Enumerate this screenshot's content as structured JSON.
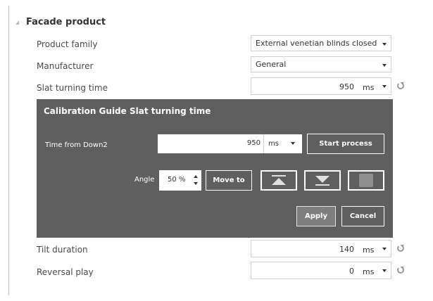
{
  "section": {
    "title": "Facade product"
  },
  "rows": {
    "product_family": {
      "label": "Product family",
      "value": "External venetian blinds closed"
    },
    "manufacturer": {
      "label": "Manufacturer",
      "value": "General"
    },
    "slat_turning_time": {
      "label": "Slat turning time",
      "value": "950",
      "unit": "ms"
    },
    "tilt_duration": {
      "label": "Tilt duration",
      "value": "140",
      "unit": "ms"
    },
    "reversal_play": {
      "label": "Reversal play",
      "value": "0",
      "unit": "ms"
    }
  },
  "dialog": {
    "title": "Calibration Guide Slat turning time",
    "time_label": "Time from Down2",
    "time_value": "950",
    "time_unit": "ms",
    "start_button": "Start process",
    "angle_label": "Angle",
    "angle_value": "50 %",
    "move_button": "Move to",
    "apply_button": "Apply",
    "cancel_button": "Cancel"
  },
  "colors": {
    "dialog_bg": "#5f5f5f",
    "refresh_icon": "#9a9a9a"
  },
  "icons": [
    "expand-triangle-icon",
    "chevron-down-icon",
    "refresh-icon",
    "spin-up-icon",
    "spin-down-icon",
    "move-up-icon",
    "move-down-icon",
    "stop-icon"
  ]
}
